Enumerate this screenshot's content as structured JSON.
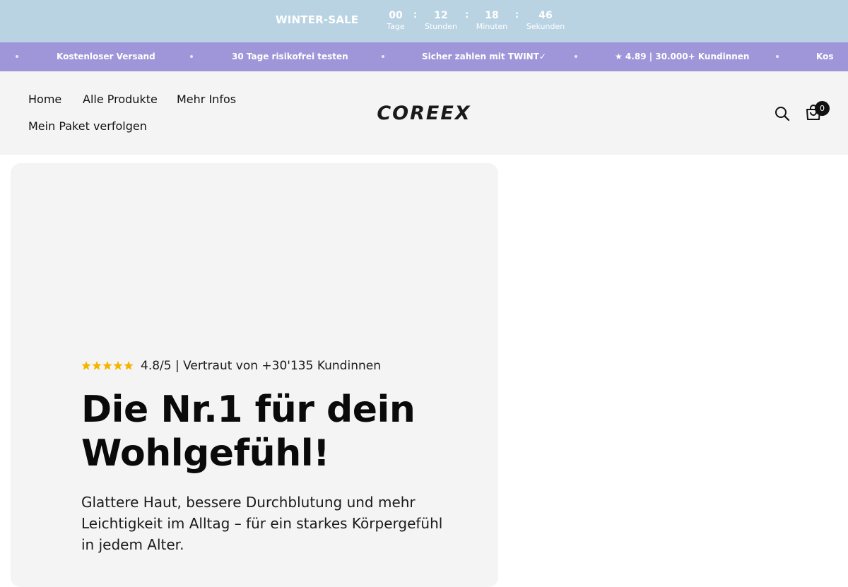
{
  "countdown": {
    "sale_label": "WINTER-SALE",
    "units": [
      {
        "value": "00",
        "label": "Tage"
      },
      {
        "value": "12",
        "label": "Stunden"
      },
      {
        "value": "18",
        "label": "Minuten"
      },
      {
        "value": "46",
        "label": "Sekunden"
      }
    ],
    "separator": ":",
    "bg_color": "#b9d3e3"
  },
  "marquee": {
    "items": [
      "Kostenloser Versand",
      "30 Tage risikofrei testen",
      "Sicher zahlen mit TWINT✓",
      "★ 4.89 | 30.000+ Kundinnen",
      "Kos"
    ],
    "bg_color": "#9e96d9"
  },
  "header": {
    "nav": [
      {
        "label": "Home"
      },
      {
        "label": "Alle Produkte"
      },
      {
        "label": "Mehr Infos"
      },
      {
        "label": "Mein Paket verfolgen"
      }
    ],
    "logo_text": "COREEX",
    "search_icon": "search-icon",
    "cart_icon": "cart-icon",
    "cart_count": "0"
  },
  "hero": {
    "stars": 5,
    "star_color": "#f5b400",
    "rating_text": "4.8/5 | Vertraut von +30'135 Kundinnen",
    "title": "Die Nr.1 für dein Wohlgefühl!",
    "subtitle": "Glattere Haut, bessere Durchblutung und mehr Leichtigkeit im Alltag – für ein starkes Körpergefühl in jedem Alter."
  }
}
